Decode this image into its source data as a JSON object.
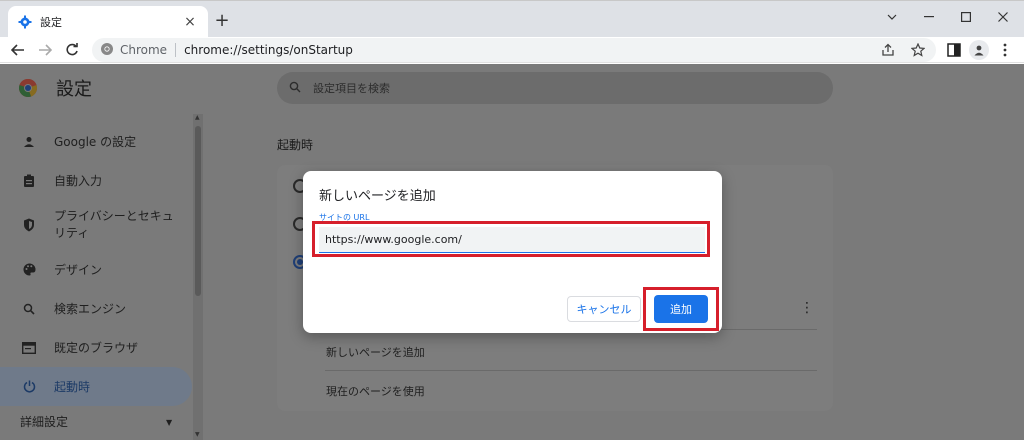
{
  "tab": {
    "title": "設定",
    "favicon": "gear-icon",
    "close": "×"
  },
  "newtab": "+",
  "window": {
    "minimize": "minimize-icon",
    "maximize": "maximize-icon",
    "close": "close-icon",
    "tab_search": "chevron-down-icon"
  },
  "omnibox": {
    "chip": "Chrome",
    "url": "chrome://settings/onStartup"
  },
  "settings": {
    "title": "設定",
    "search_placeholder": "設定項目を検索",
    "nav": [
      {
        "label": "Google の設定",
        "icon": "person-icon"
      },
      {
        "label": "自動入力",
        "icon": "clipboard-icon"
      },
      {
        "label": "プライバシーとセキュリティ",
        "icon": "shield-icon"
      },
      {
        "label": "デザイン",
        "icon": "palette-icon"
      },
      {
        "label": "検索エンジン",
        "icon": "search-icon"
      },
      {
        "label": "既定のブラウザ",
        "icon": "browser-icon"
      },
      {
        "label": "起動時",
        "icon": "power-icon",
        "active": true
      }
    ],
    "advanced": "詳細設定",
    "section_title": "起動時",
    "card_links": {
      "add_page": "新しいページを追加",
      "use_current": "現在のページを使用"
    }
  },
  "dialog": {
    "title": "新しいページを追加",
    "field_label": "サイトの URL",
    "url_value": "https://www.google.com/",
    "cancel": "キャンセル",
    "add": "追加"
  },
  "colors": {
    "accent": "#1a73e8",
    "highlight": "#d61f2b",
    "overlay": "#7a7a7a"
  }
}
